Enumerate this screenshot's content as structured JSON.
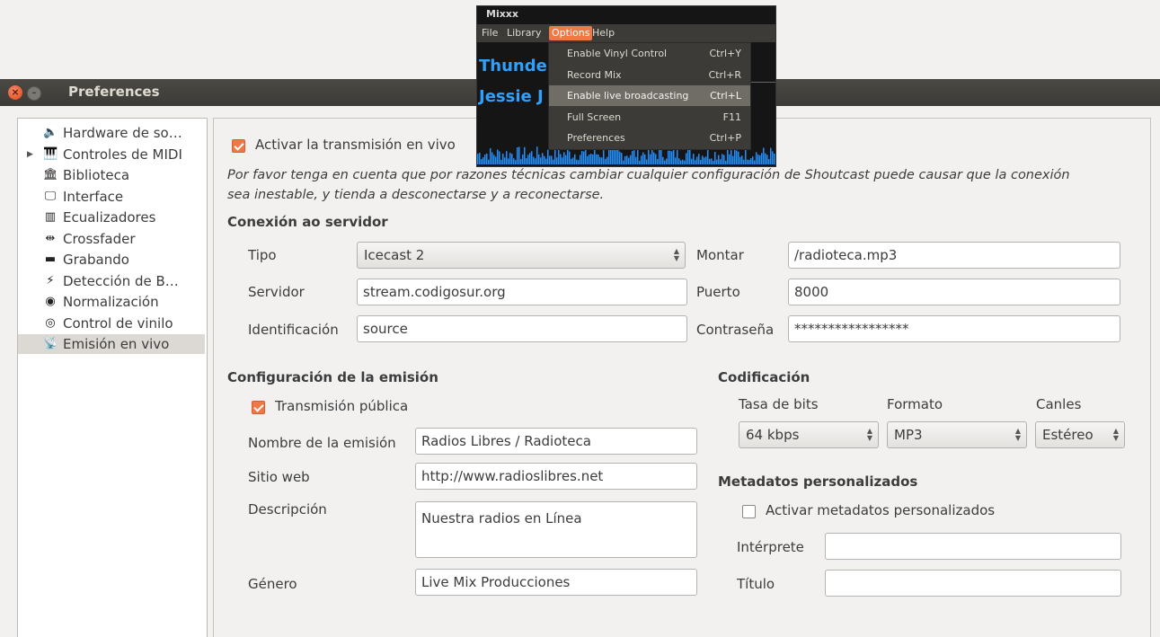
{
  "window": {
    "title": "Preferences"
  },
  "sidebar": {
    "items": [
      {
        "icon": "speaker-icon",
        "glyph": "🔈",
        "label": "Hardware de so…",
        "expander": ""
      },
      {
        "icon": "midi-keyboard-icon",
        "glyph": "🎹",
        "label": "Controles de MIDI",
        "expander": "▶"
      },
      {
        "icon": "library-icon",
        "glyph": "🏛",
        "label": "Biblioteca",
        "expander": ""
      },
      {
        "icon": "monitor-icon",
        "glyph": "🖵",
        "label": "Interface",
        "expander": ""
      },
      {
        "icon": "equalizer-icon",
        "glyph": "▥",
        "label": "Ecualizadores",
        "expander": ""
      },
      {
        "icon": "crossfader-icon",
        "glyph": "⇹",
        "label": "Crossfader",
        "expander": ""
      },
      {
        "icon": "recorder-icon",
        "glyph": "▬",
        "label": "Grabando",
        "expander": ""
      },
      {
        "icon": "wand-icon",
        "glyph": "⚡",
        "label": "Detección de B…",
        "expander": ""
      },
      {
        "icon": "normalize-icon",
        "glyph": "◉",
        "label": "Normalización",
        "expander": ""
      },
      {
        "icon": "vinyl-icon",
        "glyph": "◎",
        "label": "Control de vinilo",
        "expander": ""
      },
      {
        "icon": "broadcast-icon",
        "glyph": "📡",
        "label": "Emisión en vivo",
        "expander": ""
      }
    ],
    "selected_index": 10
  },
  "live": {
    "enable_label": "Activar la transmisión en vivo",
    "enable_checked": true,
    "warning": "Por favor tenga en cuenta que por razones técnicas cambiar cualquier configuración de Shoutcast puede causar que la conexión",
    "warning2": "sea inestable, y tienda a desconectarse y a reconectarse."
  },
  "server": {
    "heading": "Conexión ao servidor",
    "tipo_label": "Tipo",
    "tipo_value": "Icecast 2",
    "montar_label": "Montar",
    "montar_value": "/radioteca.mp3",
    "servidor_label": "Servidor",
    "servidor_value": "stream.codigosur.org",
    "puerto_label": "Puerto",
    "puerto_value": "8000",
    "ident_label": "Identificación",
    "ident_value": "source",
    "pass_label": "Contraseña",
    "pass_value": "*****************"
  },
  "stream": {
    "heading": "Configuración de la emisión",
    "public_label": "Transmisión pública",
    "public_checked": true,
    "name_label": "Nombre de la emisión",
    "name_value": "Radios Libres / Radioteca",
    "web_label": "Sitio web",
    "web_value": "http://www.radioslibres.net",
    "desc_label": "Descripción",
    "desc_value": "Nuestra radios en Línea",
    "genre_label": "Género",
    "genre_value": "Live Mix Producciones"
  },
  "encoding": {
    "heading": "Codificación",
    "bitrate_label": "Tasa de bits",
    "bitrate_value": "64 kbps",
    "format_label": "Formato",
    "format_value": "MP3",
    "channels_label": "Canles",
    "channels_value": "Estéreo"
  },
  "metadata": {
    "heading": "Metadatos personalizados",
    "enable_label": "Activar metadatos personalizados",
    "enable_checked": false,
    "artist_label": "Intérprete",
    "artist_value": "",
    "title_label": "Título",
    "title_value": ""
  },
  "mixxx": {
    "title": "Mixxx",
    "menu": [
      "File",
      "Library",
      "Options",
      "Help"
    ],
    "active_menu": "Options",
    "deck1": "Thunde",
    "deck2": "Jessie J",
    "dropdown": [
      {
        "label": "Enable Vinyl Control",
        "shortcut": "Ctrl+Y"
      },
      {
        "label": "Record Mix",
        "shortcut": "Ctrl+R"
      },
      {
        "label": "Enable live broadcasting",
        "shortcut": "Ctrl+L"
      },
      {
        "label": "Full Screen",
        "shortcut": "F11"
      },
      {
        "label": "Preferences",
        "shortcut": "Ctrl+P"
      }
    ],
    "highlighted_index": 2
  },
  "colors": {
    "accent": "#f07746",
    "titlebar": "#3c3b37",
    "deck_text": "#2ea1ff",
    "waveform": "#1e90ff"
  }
}
